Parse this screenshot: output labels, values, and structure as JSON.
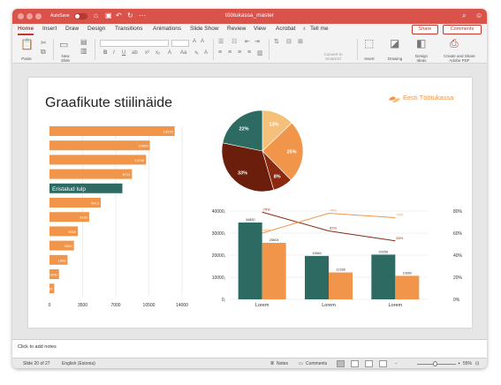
{
  "titlebar": {
    "autosave_label": "AutoSave",
    "autosave_state": "OFF",
    "document_title": "töötukassa_master"
  },
  "ribbon": {
    "tabs": [
      "Home",
      "Insert",
      "Draw",
      "Design",
      "Transitions",
      "Animations",
      "Slide Show",
      "Review",
      "View",
      "Acrobat"
    ],
    "tell_me": "Tell me",
    "share_label": "Share",
    "comments_label": "Comments",
    "paste_label": "Paste",
    "new_slide_label": "New\nSlide",
    "convert_label": "Convert to\nSmartArt",
    "insert_label": "Insert",
    "drawing_label": "Drawing",
    "design_ideas_label": "Design\nIdeas",
    "create_share_label": "Create and Share\nAdobe PDF"
  },
  "slide": {
    "title": "Graafikute stiilinäide",
    "logo_text": "Eesti Töötukassa"
  },
  "notes": {
    "placeholder": "Click to add notes"
  },
  "status": {
    "slide_counter": "Slide 20 of 27",
    "language": "English (Estonia)",
    "notes_label": "Notes",
    "comments_label": "Comments",
    "zoom": "55%"
  },
  "colors": {
    "accent_red": "#d9534b",
    "orange": "#f0954a",
    "teal": "#2d6b62",
    "light_orange": "#f5c07a",
    "dark_red": "#6b1e0c",
    "brown": "#8b2a10"
  },
  "chart_data": [
    {
      "type": "bar",
      "orientation": "horizontal",
      "values": [
        13225,
        10600,
        10196,
        8711,
        7700,
        5413,
        4190,
        3000,
        2583,
        1908,
        1000,
        500
      ],
      "highlight_index": 4,
      "highlight_label": "Eristatud tulp",
      "data_labels": [
        "13225",
        "10600",
        "10196",
        "8711",
        "",
        "5413",
        "4190",
        "3000",
        "2583",
        "1908",
        "1000",
        "500"
      ],
      "xlim": [
        0,
        14000
      ],
      "xticks": [
        "0",
        "3500",
        "7000",
        "10500",
        "14000"
      ]
    },
    {
      "type": "pie",
      "values": [
        13,
        25,
        8,
        33,
        22
      ],
      "labels": [
        "13%",
        "25%",
        "8%",
        "33%",
        "22%"
      ],
      "colors": [
        "#f5c07a",
        "#f0954a",
        "#8b2a10",
        "#6b1e0c",
        "#2d6b62"
      ]
    },
    {
      "type": "bar+line",
      "categories": [
        "Lorem",
        "Lorem",
        "Lorem"
      ],
      "series": [
        {
          "values": [
            34800,
            25604,
            0
          ],
          "labels": [
            "34800",
            "25604",
            ""
          ]
        },
        {
          "values": [
            19660,
            12186,
            0
          ],
          "labels": [
            "19660",
            "12186",
            ""
          ]
        },
        {
          "values": [
            20256,
            10650,
            0
          ],
          "labels": [
            "20256",
            "10650",
            ""
          ]
        }
      ],
      "bars_teal": [
        34800,
        19660,
        20256
      ],
      "bars_orange": [
        25604,
        12186,
        10650
      ],
      "bar_labels_teal": [
        "34800",
        "19660",
        "20256"
      ],
      "bar_labels_orange": [
        "25604",
        "12186",
        "10650"
      ],
      "lines": [
        {
          "color": "#8b2a10",
          "values": [
            79,
            62,
            53
          ],
          "labels": [
            "79%",
            "62%",
            "53%"
          ]
        },
        {
          "color": "#f0954a",
          "values": [
            60,
            78,
            74
          ],
          "labels": [
            "60%",
            "78%",
            "74%"
          ]
        }
      ],
      "ylim_left": [
        0,
        40000
      ],
      "yticks_left": [
        "40000,",
        "30000,",
        "20000,",
        "10000,",
        "0,"
      ],
      "ylim_right": [
        0,
        80
      ],
      "yticks_right": [
        "80%",
        "60%",
        "40%",
        "20%",
        "0%"
      ]
    }
  ]
}
